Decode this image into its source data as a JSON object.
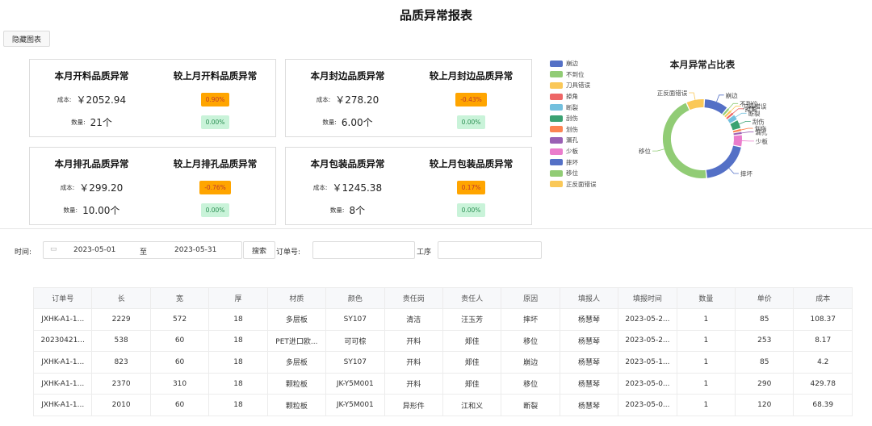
{
  "page_title": "品质异常报表",
  "hide_chart_button": "隐藏图表",
  "colors": {
    "badge_negative_bg": "#ffa500",
    "badge_zero_bg": "#c9f3d9"
  },
  "cards": [
    {
      "title": "本月开料品质异常",
      "compare_title": "较上月开料品质异常",
      "cost_label": "成本:",
      "cost": "￥2052.94",
      "qty_label": "数量:",
      "qty": "21个",
      "cost_change": "0.90%",
      "qty_change": "0.00%"
    },
    {
      "title": "本月封边品质异常",
      "compare_title": "较上月封边品质异常",
      "cost_label": "成本:",
      "cost": "￥278.20",
      "qty_label": "数量:",
      "qty": "6.00个",
      "cost_change": "-0.43%",
      "qty_change": "0.00%"
    },
    {
      "title": "本月排孔品质异常",
      "compare_title": "较上月排孔品质异常",
      "cost_label": "成本:",
      "cost": "￥299.20",
      "qty_label": "数量:",
      "qty": "10.00个",
      "cost_change": "-0.76%",
      "qty_change": "0.00%"
    },
    {
      "title": "本月包装品质异常",
      "compare_title": "较上月包装品质异常",
      "cost_label": "成本:",
      "cost": "￥1245.38",
      "qty_label": "数量:",
      "qty": "8个",
      "cost_change": "0.17%",
      "qty_change": "0.00%"
    }
  ],
  "chart_data": {
    "type": "pie",
    "title": "本月异常占比表",
    "donut": true,
    "legend_position": "left",
    "categories": [
      "崩边",
      "不到位",
      "刀具错误",
      "掉角",
      "断裂",
      "刮伤",
      "划伤",
      "漏孔",
      "少板",
      "摔坏",
      "移位",
      "正反面错误"
    ],
    "colors": [
      "#5470c6",
      "#91cc75",
      "#fac858",
      "#ee6666",
      "#73c0de",
      "#3ba272",
      "#fc8452",
      "#9a60b4",
      "#ea7ccc",
      "#5470c6",
      "#91cc75",
      "#fac858"
    ],
    "values": [
      8,
      1,
      1,
      1,
      2,
      3,
      1,
      1,
      4,
      16,
      36,
      6
    ]
  },
  "filters": {
    "time_label": "时间:",
    "date_start": "2023-05-01",
    "date_sep": "至",
    "date_end": "2023-05-31",
    "search_button": "搜索",
    "order_label": "订单号:",
    "order_value": "",
    "process_label": "工序",
    "process_value": ""
  },
  "table": {
    "columns": [
      "订单号",
      "长",
      "宽",
      "厚",
      "材质",
      "颜色",
      "责任岗",
      "责任人",
      "原因",
      "填报人",
      "填报时间",
      "数量",
      "单价",
      "成本"
    ],
    "rows": [
      [
        "JXHK-A1-1...",
        "2229",
        "572",
        "18",
        "多层板",
        "SY107",
        "清洁",
        "汪玉芳",
        "摔坏",
        "杨慧琴",
        "2023-05-2...",
        "1",
        "85",
        "108.37"
      ],
      [
        "20230421...",
        "538",
        "60",
        "18",
        "PET进口欧...",
        "可可棕",
        "开料",
        "郑佳",
        "移位",
        "杨慧琴",
        "2023-05-2...",
        "1",
        "253",
        "8.17"
      ],
      [
        "JXHK-A1-1...",
        "823",
        "60",
        "18",
        "多层板",
        "SY107",
        "开料",
        "郑佳",
        "崩边",
        "杨慧琴",
        "2023-05-1...",
        "1",
        "85",
        "4.2"
      ],
      [
        "JXHK-A1-1...",
        "2370",
        "310",
        "18",
        "颗粒板",
        "JK-Y5M001",
        "开料",
        "郑佳",
        "移位",
        "杨慧琴",
        "2023-05-0...",
        "1",
        "290",
        "429.78"
      ],
      [
        "JXHK-A1-1...",
        "2010",
        "60",
        "18",
        "颗粒板",
        "JK-Y5M001",
        "异形件",
        "江和义",
        "断裂",
        "杨慧琴",
        "2023-05-0...",
        "1",
        "120",
        "68.39"
      ]
    ]
  }
}
